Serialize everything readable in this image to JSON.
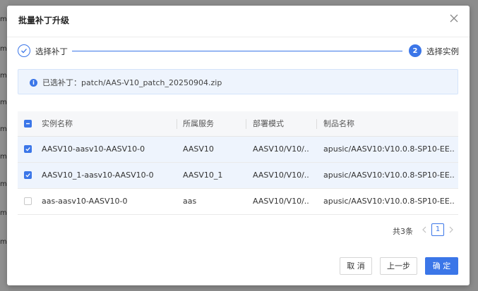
{
  "background": {
    "row_marks": [
      "m",
      "m",
      "m",
      "m",
      "m",
      "m",
      "m",
      "m",
      "m"
    ]
  },
  "dialog": {
    "title": "批量补丁升级"
  },
  "steps": [
    {
      "label": "选择补丁",
      "status": "done"
    },
    {
      "number": "2",
      "label": "选择实例",
      "status": "active"
    }
  ],
  "info": {
    "text": "已选补丁：patch/AAS-V10_patch_20250904.zip"
  },
  "table": {
    "columns": [
      "实例名称",
      "所属服务",
      "部署模式",
      "制品名称"
    ],
    "rows": [
      {
        "checked": true,
        "name": "AASV10-aasv10-AASV10-0",
        "service": "AASV10",
        "mode": "AASV10/V10/...",
        "product": "apusic/AASV10:V10.0.8-SP10-EE..."
      },
      {
        "checked": true,
        "name": "AASV10_1-aasv10-AASV10-0",
        "service": "AASV10_1",
        "mode": "AASV10/V10/...",
        "product": "apusic/AASV10:V10.0.8-SP10-EE..."
      },
      {
        "checked": false,
        "name": "aas-aasv10-AASV10-0",
        "service": "aas",
        "mode": "AASV10/V10/...",
        "product": "apusic/AASV10:V10.0.8-SP10-EE..."
      }
    ]
  },
  "pagination": {
    "total": "共3条",
    "current_page": "1"
  },
  "footer": {
    "cancel_label": "取 消",
    "prev_label": "上一步",
    "confirm_label": "确 定"
  },
  "colors": {
    "primary": "#3b76e8",
    "selected_row": "#eef4fd",
    "alert_bg": "#eef4fd"
  }
}
